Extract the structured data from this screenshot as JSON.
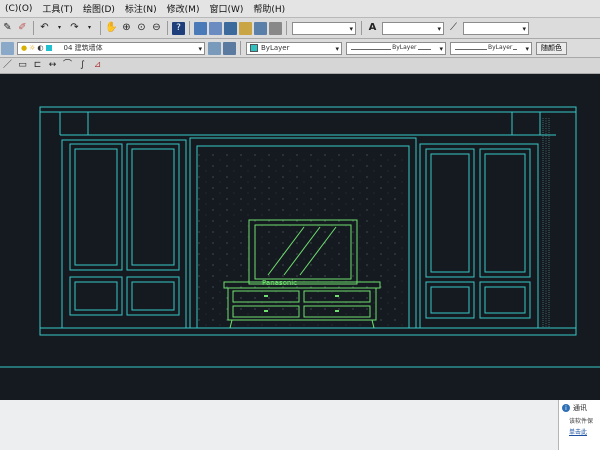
{
  "menu": [
    "(C)(O)",
    "工具(T)",
    "绘图(D)",
    "标注(N)",
    "修改(M)",
    "窗口(W)",
    "帮助(H)"
  ],
  "layers": {
    "current_layer_label": "04 建筑墙体"
  },
  "properties": {
    "color": "ByLayer",
    "linetype": "ByLayer",
    "lineweight": "ByLayer",
    "plot_style": "随颜色"
  },
  "drawing": {
    "tv_brand": "Panasonic"
  },
  "notification": {
    "title": "通讯",
    "body": "该软件保",
    "link": "单击此"
  },
  "colors": {
    "wall_lines": "#37c8c8",
    "furniture_lines": "#6ee06e",
    "canvas_bg": "#151a20"
  },
  "icons": {
    "toolbar1": [
      "pencil-icon",
      "brush-icon",
      "undo-icon",
      "redo-icon",
      "pan-icon",
      "zoom-realtime-icon",
      "zoom-window-icon",
      "zoom-previous-icon",
      "help-icon",
      "properties-icon",
      "design-center-icon",
      "tool-palette-icon",
      "sheet-set-icon",
      "markup-icon",
      "calculator-icon",
      "text-style-icon",
      "dim-style-icon"
    ],
    "toolbar3": [
      "line-icon",
      "rectangle-icon",
      "polyline-icon",
      "dimension-icon",
      "arc-icon",
      "spline-icon",
      "measure-icon"
    ]
  }
}
